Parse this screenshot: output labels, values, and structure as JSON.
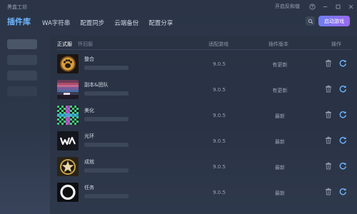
{
  "app": {
    "title": "黑盒工坊"
  },
  "titlebar": {
    "feedback": "开启反和值",
    "icons": [
      "help-icon",
      "minimize-icon",
      "maximize-icon",
      "close-icon"
    ]
  },
  "nav": {
    "items": [
      {
        "label": "插件库",
        "active": true
      },
      {
        "label": "WA字符串",
        "active": false
      },
      {
        "label": "配置同步",
        "active": false
      },
      {
        "label": "云端备份",
        "active": false
      },
      {
        "label": "配置分享",
        "active": false
      }
    ]
  },
  "actions": {
    "launch_label": "启动游戏"
  },
  "table": {
    "tabs": [
      {
        "label": "正式服",
        "active": true
      },
      {
        "label": "怀旧服",
        "active": false
      }
    ],
    "headers": {
      "compat": "适配游戏",
      "plugin_version": "插件版本",
      "ops": "操作"
    },
    "rows": [
      {
        "name": "整合",
        "version": "9.0.5",
        "status": "有更新",
        "icon": "paw-badge-icon"
      },
      {
        "name": "副本&团队",
        "version": "9.0.5",
        "status": "有更新",
        "icon": "gradient-stripes-icon"
      },
      {
        "name": "美化",
        "version": "9.0.5",
        "status": "最新",
        "icon": "checker-icon"
      },
      {
        "name": "光环",
        "version": "9.0.5",
        "status": "最新",
        "icon": "wa-logo-icon"
      },
      {
        "name": "成就",
        "version": "9.0.5",
        "status": "最新",
        "icon": "star-badge-icon"
      },
      {
        "name": "任务",
        "version": "9.0.5",
        "status": "最新",
        "icon": "ring-icon"
      }
    ]
  },
  "colors": {
    "accent": "#6fb6ff",
    "launch_start": "#6f7df1",
    "launch_end": "#9a6af0"
  }
}
